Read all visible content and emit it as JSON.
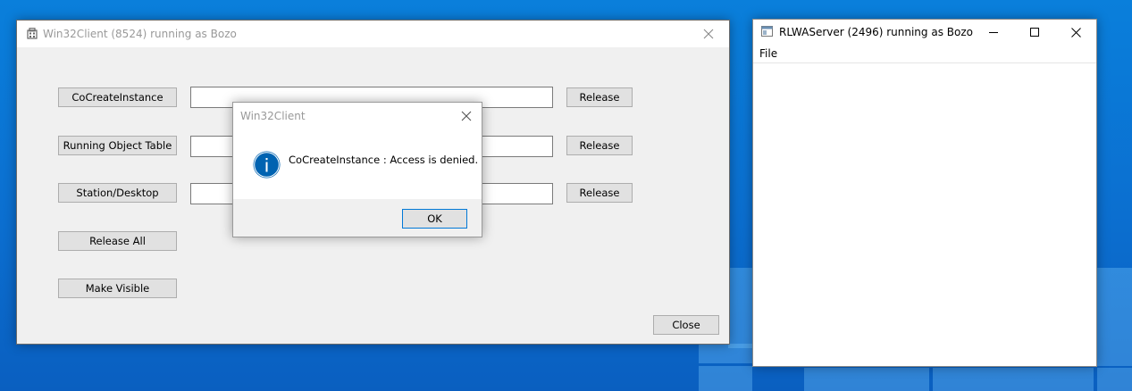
{
  "win32client": {
    "title": "Win32Client (8524) running as Bozo",
    "rows": [
      {
        "action_label": "CoCreateInstance",
        "value": "",
        "release_label": "Release"
      },
      {
        "action_label": "Running Object Table",
        "value": "",
        "release_label": "Release"
      },
      {
        "action_label": "Station/Desktop",
        "value": "",
        "release_label": "Release"
      }
    ],
    "release_all_label": "Release All",
    "make_visible_label": "Make Visible",
    "close_label": "Close"
  },
  "dialog": {
    "title": "Win32Client",
    "message": "CoCreateInstance : Access is denied.",
    "ok_label": "OK",
    "icon": "info-icon",
    "icon_color": "#0063b1"
  },
  "rlwaserver": {
    "title": "RLWAServer (2496) running as Bozo",
    "menu": [
      "File"
    ]
  },
  "colors": {
    "desktop": "#0a78d7",
    "dialog_gray": "#f0f0f0",
    "button_face": "#e1e1e1"
  }
}
